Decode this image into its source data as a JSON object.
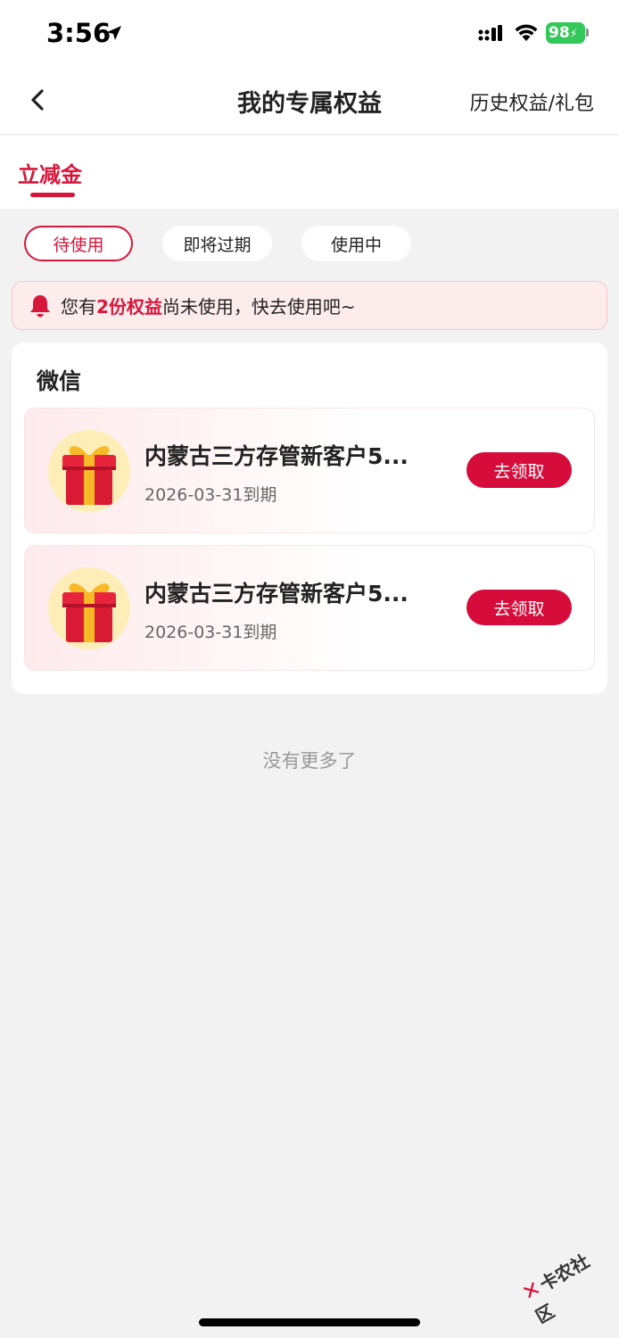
{
  "status_bar": {
    "time": "3:56",
    "battery": "98",
    "icons": [
      "location-arrow-icon",
      "signal-icon",
      "wifi-icon",
      "battery-icon"
    ]
  },
  "nav": {
    "title": "我的专属权益",
    "right_link": "历史权益/礼包",
    "back_icon": "chevron-left-icon"
  },
  "tabs": [
    {
      "label": "立减金",
      "active": true
    }
  ],
  "filters": [
    {
      "label": "待使用",
      "active": true
    },
    {
      "label": "即将过期",
      "active": false
    },
    {
      "label": "使用中",
      "active": false
    }
  ],
  "notice": {
    "prefix": "您有",
    "highlight": "2份权益",
    "suffix": "尚未使用，快去使用吧~",
    "icon": "bell-icon"
  },
  "section": {
    "title": "微信",
    "items": [
      {
        "title": "内蒙古三方存管新客户5...",
        "date": "2026-03-31到期",
        "button": "去领取",
        "icon": "gift-box-icon"
      },
      {
        "title": "内蒙古三方存管新客户5...",
        "date": "2026-03-31到期",
        "button": "去领取",
        "icon": "gift-box-icon"
      }
    ]
  },
  "footer_text": "没有更多了",
  "watermark": "卡农社区",
  "colors": {
    "accent": "#d6163b",
    "background": "#f2f2f2"
  }
}
